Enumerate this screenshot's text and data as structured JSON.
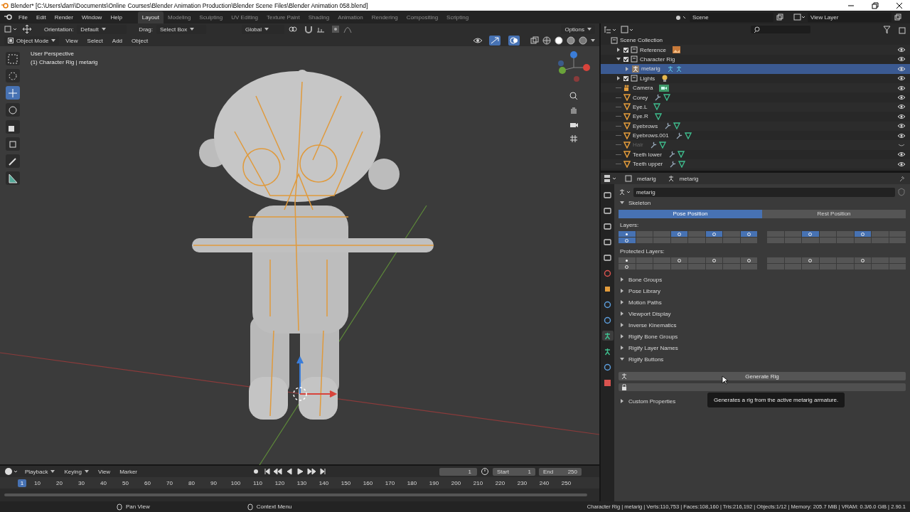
{
  "window": {
    "title": "Blender* [C:\\Users\\darri\\Documents\\Online Courses\\Blender Animation Production\\Blender Scene Files\\Blender Animation 058.blend]"
  },
  "menu": [
    "File",
    "Edit",
    "Render",
    "Window",
    "Help"
  ],
  "workspaces": [
    {
      "label": "Layout",
      "selected": true
    },
    {
      "label": "Modeling",
      "selected": false
    },
    {
      "label": "Sculpting",
      "selected": false
    },
    {
      "label": "UV Editing",
      "selected": false
    },
    {
      "label": "Texture Paint",
      "selected": false
    },
    {
      "label": "Shading",
      "selected": false
    },
    {
      "label": "Animation",
      "selected": false
    },
    {
      "label": "Rendering",
      "selected": false
    },
    {
      "label": "Compositing",
      "selected": false
    },
    {
      "label": "Scripting",
      "selected": false
    }
  ],
  "scene": "Scene",
  "view_layer": "View Layer",
  "viewport": {
    "orientation_label": "Orientation:",
    "orientation": "Default",
    "drag_label": "Drag:",
    "drag": "Select Box",
    "transform_orientation": "Global",
    "options": "Options",
    "mode": "Object Mode",
    "menus": [
      "View",
      "Select",
      "Add",
      "Object"
    ],
    "shading": [
      {
        "kind": "wireframe",
        "selected": false
      },
      {
        "kind": "solid",
        "selected": true
      },
      {
        "kind": "material",
        "selected": false
      },
      {
        "kind": "rendered",
        "selected": false
      }
    ],
    "tools": [
      {
        "kind": "select",
        "selected": false
      },
      {
        "kind": "cursor",
        "selected": false
      },
      {
        "kind": "move",
        "selected": true
      },
      {
        "kind": "rotate",
        "selected": false
      },
      {
        "kind": "scale",
        "selected": false
      },
      {
        "kind": "transform",
        "selected": false
      },
      {
        "kind": "annotate",
        "selected": false
      },
      {
        "kind": "measure",
        "selected": false
      }
    ],
    "view_name": "User Perspective",
    "object_info": "(1) Character Rig | metarig"
  },
  "outliner": {
    "root": "Scene Collection",
    "items": [
      {
        "name": "Reference",
        "kind": "collection",
        "checked": true,
        "expanded": false,
        "holds_images": true,
        "visible": true
      },
      {
        "name": "Character Rig",
        "kind": "collection",
        "checked": true,
        "expanded": true,
        "visible": true,
        "children": [
          {
            "name": "metarig",
            "kind": "armature",
            "expanded": false,
            "selected": true,
            "visible": true
          }
        ]
      },
      {
        "name": "Lights",
        "kind": "collection",
        "checked": true,
        "expanded": false,
        "holds_lights": true,
        "visible": true
      },
      {
        "name": "Camera",
        "kind": "camera",
        "visible": true
      },
      {
        "name": "Corey",
        "kind": "mesh",
        "modifiers": true,
        "visible": true
      },
      {
        "name": "Eye.L",
        "kind": "mesh",
        "modifiers": false,
        "visible": true
      },
      {
        "name": "Eye.R",
        "kind": "mesh",
        "modifiers": false,
        "visible": true
      },
      {
        "name": "Eyebrows",
        "kind": "mesh",
        "modifiers": true,
        "visible": true
      },
      {
        "name": "Eyebrows.001",
        "kind": "mesh",
        "modifiers": true,
        "visible": true
      },
      {
        "name": "Hair",
        "kind": "mesh",
        "modifiers": true,
        "visible": false
      },
      {
        "name": "Teeth lower",
        "kind": "mesh",
        "modifiers": true,
        "visible": true
      },
      {
        "name": "Teeth upper",
        "kind": "mesh",
        "modifiers": true,
        "visible": true
      }
    ]
  },
  "properties": {
    "object": "metarig",
    "data": "metarig",
    "name_field": "metarig",
    "tabs": [
      {
        "kind": "tool",
        "selected": false
      },
      {
        "kind": "render",
        "selected": false
      },
      {
        "kind": "output",
        "selected": false
      },
      {
        "kind": "view_layer",
        "selected": false
      },
      {
        "kind": "scene",
        "selected": false
      },
      {
        "kind": "world",
        "selected": false
      },
      {
        "kind": "object",
        "selected": false
      },
      {
        "kind": "physics",
        "selected": false
      },
      {
        "kind": "constraints",
        "selected": false
      },
      {
        "kind": "armature",
        "selected": true
      },
      {
        "kind": "bone",
        "selected": false
      },
      {
        "kind": "bone_constraints",
        "selected": false
      },
      {
        "kind": "texture",
        "selected": false
      }
    ],
    "skeleton": {
      "title": "Skeleton",
      "expanded": true,
      "positions": [
        {
          "label": "Pose Position",
          "selected": true
        },
        {
          "label": "Rest Position",
          "selected": false
        }
      ],
      "layers_label": "Layers:",
      "layers": [
        {
          "selected": true,
          "kind": "dot"
        },
        {
          "selected": false,
          "kind": "empty"
        },
        {
          "selected": false,
          "kind": "empty"
        },
        {
          "selected": true,
          "kind": "ring"
        },
        {
          "selected": false,
          "kind": "empty"
        },
        {
          "selected": true,
          "kind": "ring"
        },
        {
          "selected": false,
          "kind": "empty"
        },
        {
          "selected": true,
          "kind": "ring"
        },
        {
          "selected": false,
          "kind": "empty"
        },
        {
          "selected": false,
          "kind": "empty"
        },
        {
          "selected": true,
          "kind": "ring"
        },
        {
          "selected": false,
          "kind": "empty"
        },
        {
          "selected": false,
          "kind": "empty"
        },
        {
          "selected": true,
          "kind": "ring"
        },
        {
          "selected": false,
          "kind": "empty"
        },
        {
          "selected": false,
          "kind": "empty"
        },
        {
          "selected": true,
          "kind": "ring"
        },
        {
          "selected": false,
          "kind": "empty"
        },
        {
          "selected": false,
          "kind": "empty"
        },
        {
          "selected": false,
          "kind": "empty"
        },
        {
          "selected": false,
          "kind": "empty"
        },
        {
          "selected": false,
          "kind": "empty"
        },
        {
          "selected": false,
          "kind": "empty"
        },
        {
          "selected": false,
          "kind": "empty"
        },
        {
          "selected": false,
          "kind": "empty"
        },
        {
          "selected": false,
          "kind": "empty"
        },
        {
          "selected": false,
          "kind": "empty"
        },
        {
          "selected": false,
          "kind": "empty"
        },
        {
          "selected": false,
          "kind": "empty"
        },
        {
          "selected": false,
          "kind": "empty"
        },
        {
          "selected": false,
          "kind": "empty"
        },
        {
          "selected": false,
          "kind": "empty"
        }
      ],
      "protected_label": "Protected Layers:",
      "protected_layers": [
        {
          "selected": false,
          "kind": "dot"
        },
        {
          "selected": false,
          "kind": "empty"
        },
        {
          "selected": false,
          "kind": "empty"
        },
        {
          "selected": false,
          "kind": "ring"
        },
        {
          "selected": false,
          "kind": "empty"
        },
        {
          "selected": false,
          "kind": "ring"
        },
        {
          "selected": false,
          "kind": "empty"
        },
        {
          "selected": false,
          "kind": "ring"
        },
        {
          "selected": false,
          "kind": "empty"
        },
        {
          "selected": false,
          "kind": "empty"
        },
        {
          "selected": false,
          "kind": "ring"
        },
        {
          "selected": false,
          "kind": "empty"
        },
        {
          "selected": false,
          "kind": "empty"
        },
        {
          "selected": false,
          "kind": "ring"
        },
        {
          "selected": false,
          "kind": "empty"
        },
        {
          "selected": false,
          "kind": "empty"
        },
        {
          "selected": false,
          "kind": "ring"
        },
        {
          "selected": false,
          "kind": "empty"
        },
        {
          "selected": false,
          "kind": "empty"
        },
        {
          "selected": false,
          "kind": "empty"
        },
        {
          "selected": false,
          "kind": "empty"
        },
        {
          "selected": false,
          "kind": "empty"
        },
        {
          "selected": false,
          "kind": "empty"
        },
        {
          "selected": false,
          "kind": "empty"
        },
        {
          "selected": false,
          "kind": "empty"
        },
        {
          "selected": false,
          "kind": "empty"
        },
        {
          "selected": false,
          "kind": "empty"
        },
        {
          "selected": false,
          "kind": "empty"
        },
        {
          "selected": false,
          "kind": "empty"
        },
        {
          "selected": false,
          "kind": "empty"
        },
        {
          "selected": false,
          "kind": "empty"
        },
        {
          "selected": false,
          "kind": "empty"
        }
      ]
    },
    "panels": [
      {
        "title": "Bone Groups",
        "expanded": false
      },
      {
        "title": "Pose Library",
        "expanded": false
      },
      {
        "title": "Motion Paths",
        "expanded": false
      },
      {
        "title": "Viewport Display",
        "expanded": false
      },
      {
        "title": "Inverse Kinematics",
        "expanded": false
      },
      {
        "title": "Rigify Bone Groups",
        "expanded": false
      },
      {
        "title": "Rigify Layer Names",
        "expanded": false
      },
      {
        "title": "Rigify Buttons",
        "expanded": true,
        "content": {
          "button": "Generate Rig",
          "tooltip": "Generates a rig from the active metarig armature."
        }
      },
      {
        "title": "Custom Properties",
        "expanded": false
      }
    ]
  },
  "timeline": {
    "menus": [
      {
        "label": "Playback",
        "dropdown": true
      },
      {
        "label": "Keying",
        "dropdown": true
      },
      {
        "label": "View",
        "dropdown": false
      },
      {
        "label": "Marker",
        "dropdown": false
      }
    ],
    "frame_field": "1",
    "start_label": "Start",
    "start": "1",
    "end_label": "End",
    "end": "250",
    "playhead": "1",
    "ticks": [
      "10",
      "20",
      "30",
      "40",
      "50",
      "60",
      "70",
      "80",
      "90",
      "100",
      "110",
      "120",
      "130",
      "140",
      "150",
      "160",
      "170",
      "180",
      "190",
      "200",
      "210",
      "220",
      "230",
      "240",
      "250"
    ]
  },
  "status_bar": {
    "hints": [
      "Pan View",
      "Context Menu"
    ],
    "stats": "Character Rig | metarig | Verts:110,753 | Faces:108,160 | Tris:216,192 | Objects:1/12 | Memory: 205.7 MiB | VRAM: 0.3/6.0 GiB | 2.90.1"
  }
}
